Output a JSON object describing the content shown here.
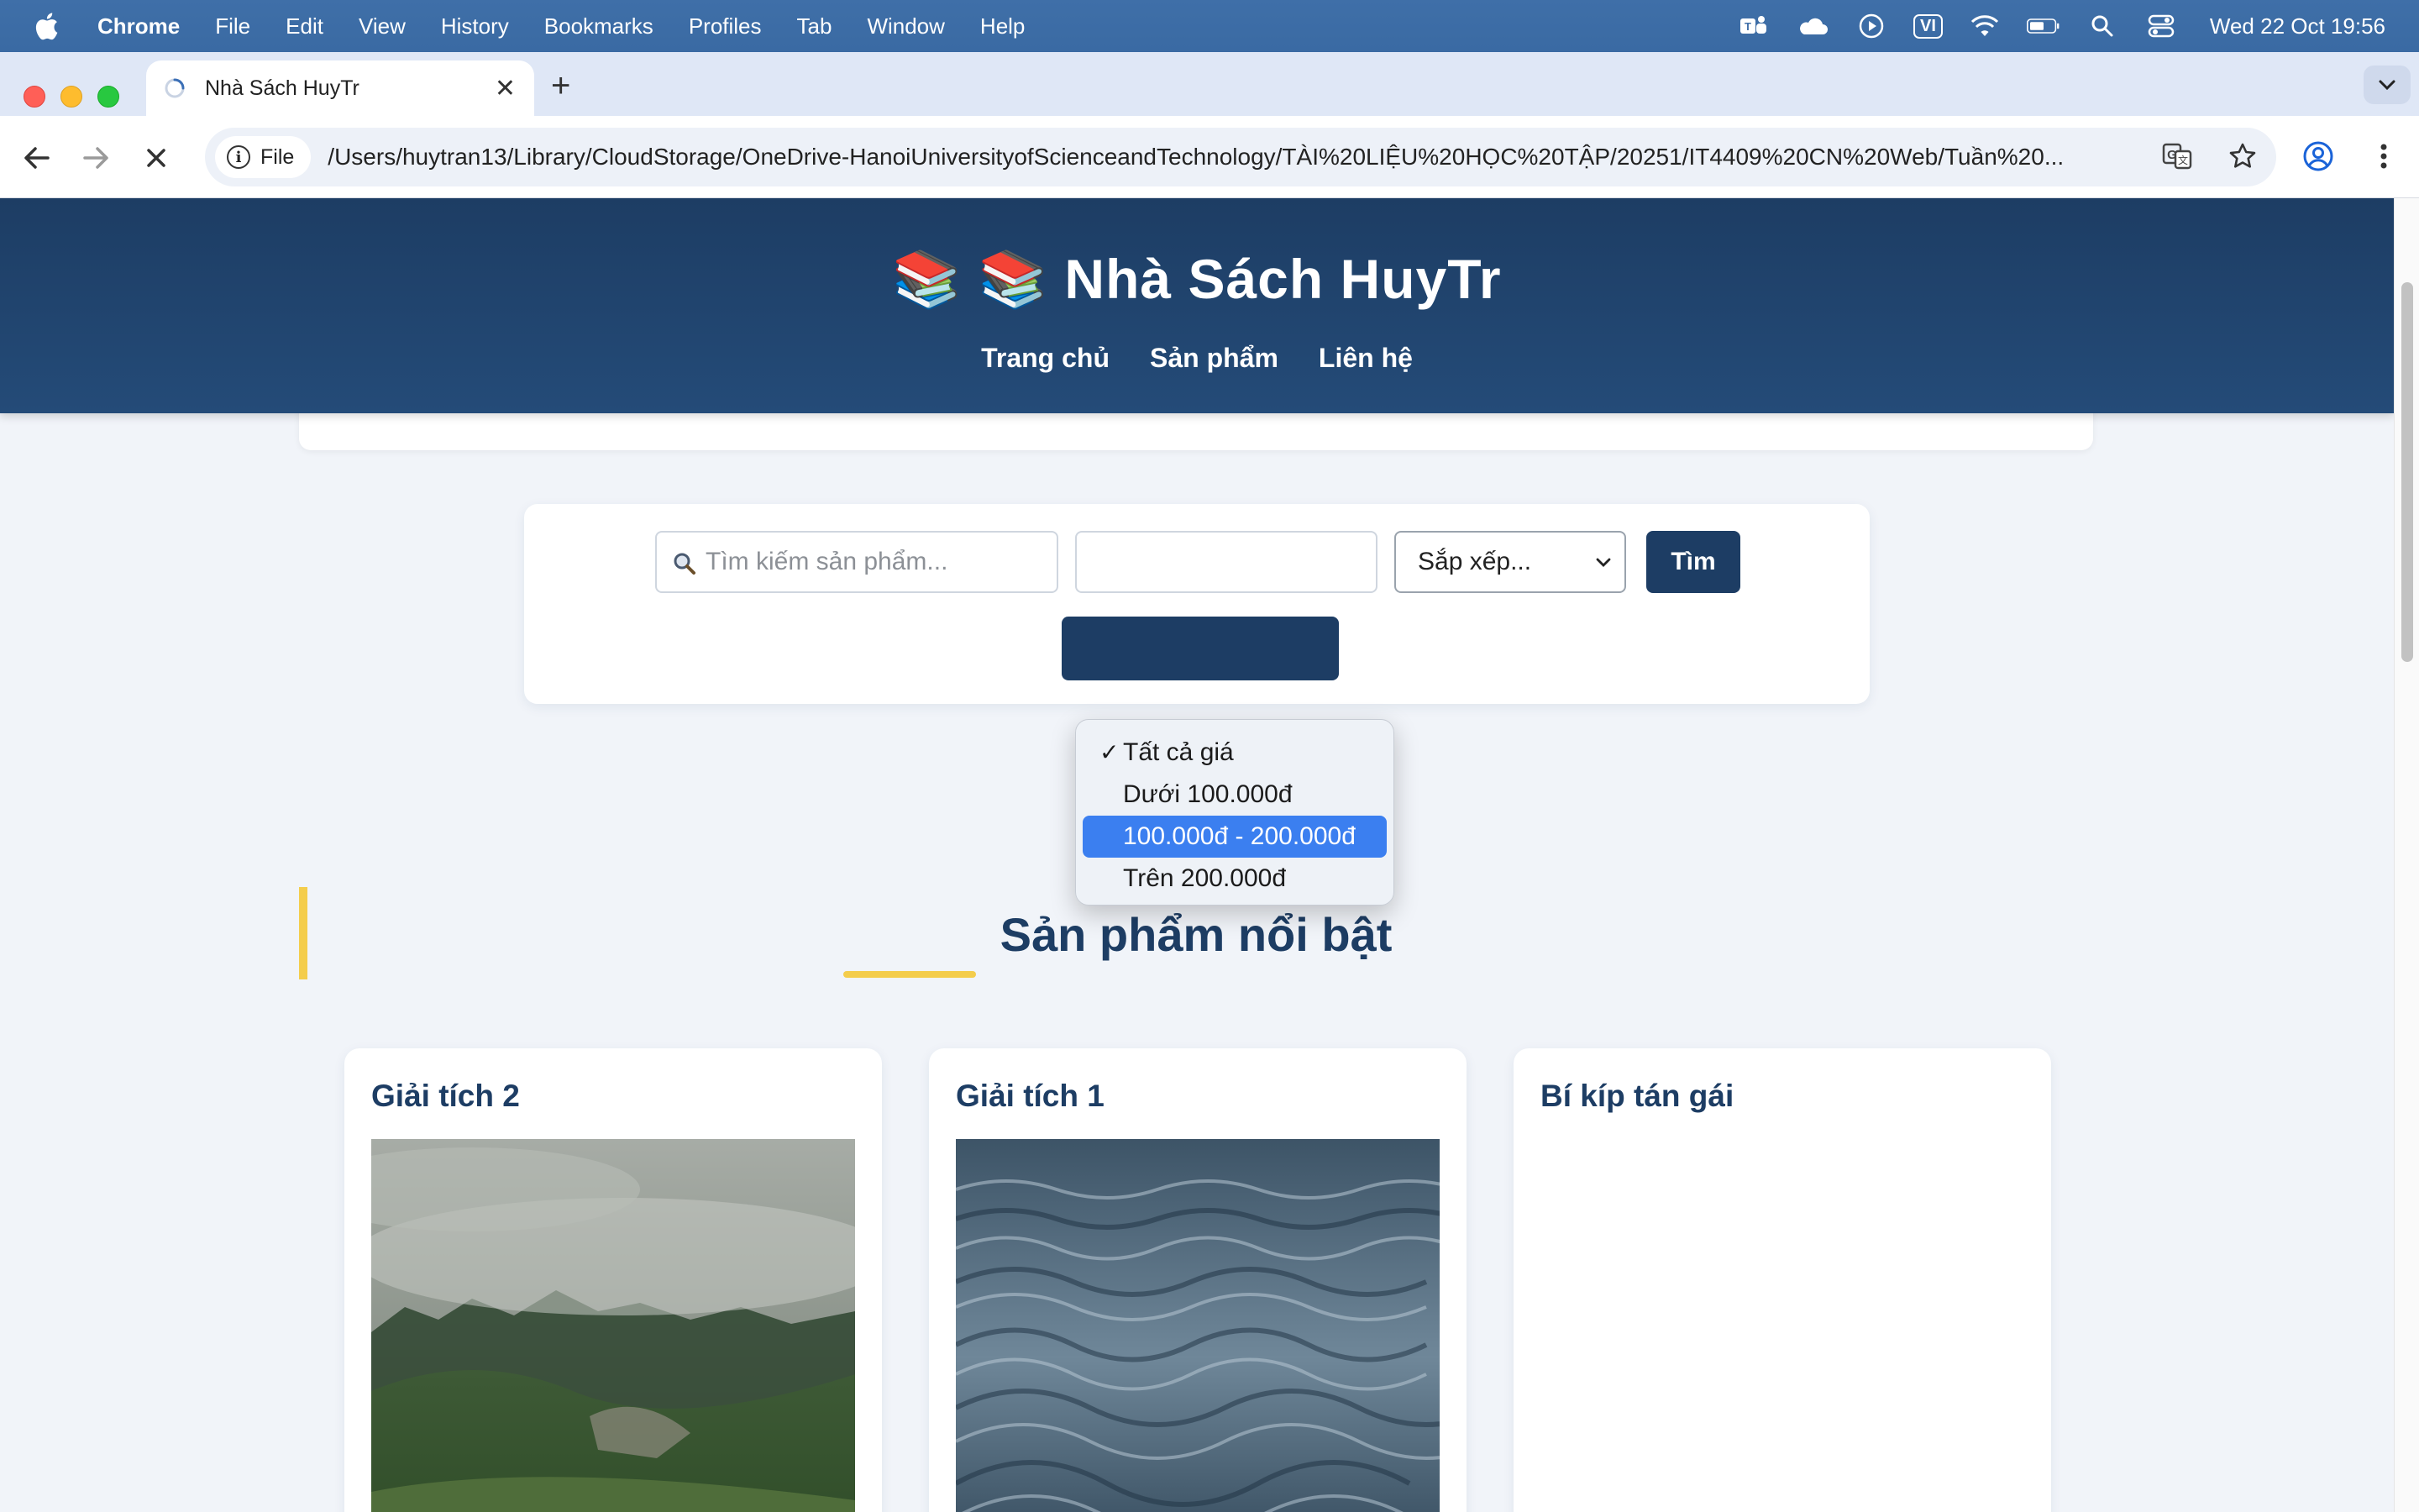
{
  "menubar": {
    "app_name": "Chrome",
    "menus": [
      "File",
      "Edit",
      "View",
      "History",
      "Bookmarks",
      "Profiles",
      "Tab",
      "Window",
      "Help"
    ],
    "input_source": "VI",
    "clock": "Wed 22 Oct  19:56"
  },
  "browser": {
    "tab_title": "Nhà Sách HuyTr",
    "site_chip": "File",
    "url": "/Users/huytran13/Library/CloudStorage/OneDrive-HanoiUniversityofScienceandTechnology/TÀI%20LIỆU%20HỌC%20TẬP/20251/IT4409%20CN%20Web/Tuần%20..."
  },
  "site": {
    "title": "📚 📚 Nhà Sách HuyTr",
    "nav": [
      "Trang chủ",
      "Sản phẩm",
      "Liên hệ"
    ]
  },
  "filter": {
    "search_placeholder": "Tìm kiếm sản phẩm...",
    "price_options": [
      "Tất cả giá",
      "Dưới 100.000đ",
      "100.000đ - 200.000đ",
      "Trên 200.000đ"
    ],
    "price_checked_index": 0,
    "price_highlight_index": 2,
    "sort_label": "Sắp xếp...",
    "search_button": "Tìm"
  },
  "featured": {
    "title": "Sản phẩm nổi bật",
    "products": [
      {
        "name": "Giải tích 2",
        "image": "misty-forest-hill"
      },
      {
        "name": "Giải tích 1",
        "image": "ocean-water-ripples"
      },
      {
        "name": "Bí kíp tán gái",
        "image": ""
      }
    ]
  },
  "colors": {
    "header_bg": "#1d3d64",
    "accent_yellow": "#f4cd4c",
    "dropdown_highlight": "#3b7ff0"
  }
}
